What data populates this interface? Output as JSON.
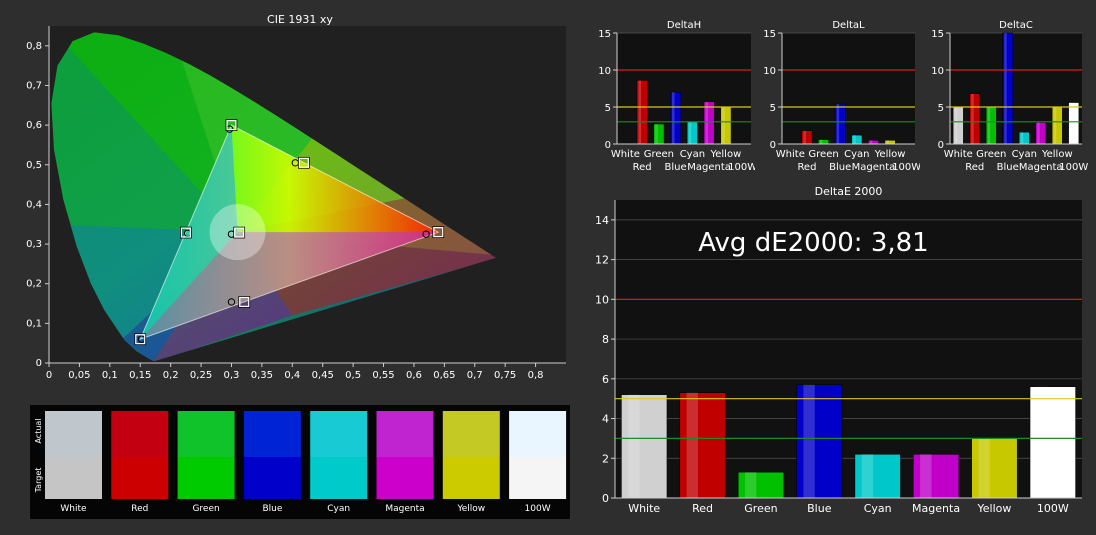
{
  "chart_data": [
    {
      "id": "cie",
      "type": "scatter",
      "title": "CIE 1931 xy",
      "xlim": [
        0,
        0.85
      ],
      "ylim": [
        0,
        0.85
      ],
      "x_ticks": [
        "0",
        "0,05",
        "0,1",
        "0,15",
        "0,2",
        "0,25",
        "0,3",
        "0,35",
        "0,4",
        "0,45",
        "0,5",
        "0,55",
        "0,6",
        "0,65",
        "0,7",
        "0,75",
        "0,8"
      ],
      "y_ticks": [
        "0",
        "0,1",
        "0,2",
        "0,3",
        "0,4",
        "0,5",
        "0,6",
        "0,7",
        "0,8"
      ],
      "target_gamut": [
        [
          0.64,
          0.33
        ],
        [
          0.3,
          0.6
        ],
        [
          0.15,
          0.06
        ]
      ],
      "targets": [
        {
          "name": "Red",
          "x": 0.64,
          "y": 0.33
        },
        {
          "name": "Green",
          "x": 0.3,
          "y": 0.6
        },
        {
          "name": "Blue",
          "x": 0.15,
          "y": 0.06
        },
        {
          "name": "Cyan",
          "x": 0.225,
          "y": 0.329
        },
        {
          "name": "Magenta",
          "x": 0.321,
          "y": 0.154
        },
        {
          "name": "Yellow",
          "x": 0.419,
          "y": 0.505
        },
        {
          "name": "White",
          "x": 0.3127,
          "y": 0.329
        }
      ],
      "measured": [
        {
          "name": "Red",
          "x": 0.62,
          "y": 0.325
        },
        {
          "name": "Green",
          "x": 0.297,
          "y": 0.59
        },
        {
          "name": "Blue",
          "x": 0.152,
          "y": 0.06
        },
        {
          "name": "Cyan",
          "x": 0.228,
          "y": 0.327
        },
        {
          "name": "Magenta",
          "x": 0.3,
          "y": 0.154
        },
        {
          "name": "Yellow",
          "x": 0.405,
          "y": 0.505
        },
        {
          "name": "White",
          "x": 0.3,
          "y": 0.325
        }
      ]
    },
    {
      "id": "deltaH",
      "type": "bar",
      "title": "DeltaH",
      "categories": [
        "White",
        "Red",
        "Green",
        "Blue",
        "Cyan",
        "Magenta",
        "Yellow",
        "100W"
      ],
      "values": [
        0,
        8.6,
        2.7,
        7.0,
        3.0,
        5.7,
        5.1,
        0
      ],
      "ylim": [
        0,
        15
      ],
      "y_ticks": [
        0,
        5,
        10,
        15
      ],
      "thresholds": [
        {
          "value": 10,
          "color": "#d82020"
        },
        {
          "value": 5,
          "color": "#d8c820"
        },
        {
          "value": 3,
          "color": "#1f8a1f"
        }
      ]
    },
    {
      "id": "deltaL",
      "type": "bar",
      "title": "DeltaL",
      "categories": [
        "White",
        "Red",
        "Green",
        "Blue",
        "Cyan",
        "Magenta",
        "Yellow",
        "100W"
      ],
      "values": [
        0,
        1.8,
        0.6,
        5.4,
        1.2,
        0.5,
        0.5,
        0
      ],
      "ylim": [
        0,
        15
      ],
      "y_ticks": [
        0,
        5,
        10,
        15
      ],
      "thresholds": [
        {
          "value": 10,
          "color": "#d82020"
        },
        {
          "value": 5,
          "color": "#d8c820"
        },
        {
          "value": 3,
          "color": "#1f8a1f"
        }
      ]
    },
    {
      "id": "deltaC",
      "type": "bar",
      "title": "DeltaC",
      "categories": [
        "White",
        "Red",
        "Green",
        "Blue",
        "Cyan",
        "Magenta",
        "Yellow",
        "100W"
      ],
      "values": [
        5.1,
        6.8,
        5.0,
        15.0,
        1.6,
        2.9,
        5.0,
        5.6
      ],
      "ylim": [
        0,
        15
      ],
      "y_ticks": [
        0,
        5,
        10,
        15
      ],
      "thresholds": [
        {
          "value": 10,
          "color": "#d82020"
        },
        {
          "value": 5,
          "color": "#d8c820"
        },
        {
          "value": 3,
          "color": "#1f8a1f"
        }
      ]
    },
    {
      "id": "deltaE",
      "type": "bar",
      "title": "DeltaE 2000",
      "annotation": "Avg dE2000: 3,81",
      "categories": [
        "White",
        "Red",
        "Green",
        "Blue",
        "Cyan",
        "Magenta",
        "Yellow",
        "100W"
      ],
      "values": [
        5.2,
        5.3,
        1.3,
        5.7,
        2.2,
        2.2,
        3.0,
        5.6
      ],
      "ylim": [
        0,
        15
      ],
      "y_ticks": [
        0,
        2,
        4,
        6,
        8,
        10,
        12,
        14
      ],
      "thresholds": [
        {
          "value": 10,
          "color": "#d82020"
        },
        {
          "value": 5,
          "color": "#d8c820"
        },
        {
          "value": 3,
          "color": "#1f8a1f"
        }
      ]
    }
  ],
  "bar_colors": {
    "White": "#d0d0d0",
    "Red": "#c00000",
    "Green": "#00c000",
    "Blue": "#0000c8",
    "Cyan": "#00c8c8",
    "Magenta": "#c000c8",
    "Yellow": "#c8c800",
    "100W": "#ffffff"
  },
  "swatches": {
    "actual_label": "Actual",
    "target_label": "Target",
    "items": [
      {
        "name": "White",
        "actual": "#bfc6cc",
        "target": "#c5c5c5"
      },
      {
        "name": "Red",
        "actual": "#c20012",
        "target": "#cc0000"
      },
      {
        "name": "Green",
        "actual": "#11c32a",
        "target": "#00cb00"
      },
      {
        "name": "Blue",
        "actual": "#0024d5",
        "target": "#0000cb"
      },
      {
        "name": "Cyan",
        "actual": "#17cad3",
        "target": "#00cbcb"
      },
      {
        "name": "Magenta",
        "actual": "#c023d0",
        "target": "#cb00cb"
      },
      {
        "name": "Yellow",
        "actual": "#c4c924",
        "target": "#cbcb00"
      },
      {
        "name": "100W",
        "actual": "#eaf6ff",
        "target": "#f5f5f5"
      }
    ]
  }
}
